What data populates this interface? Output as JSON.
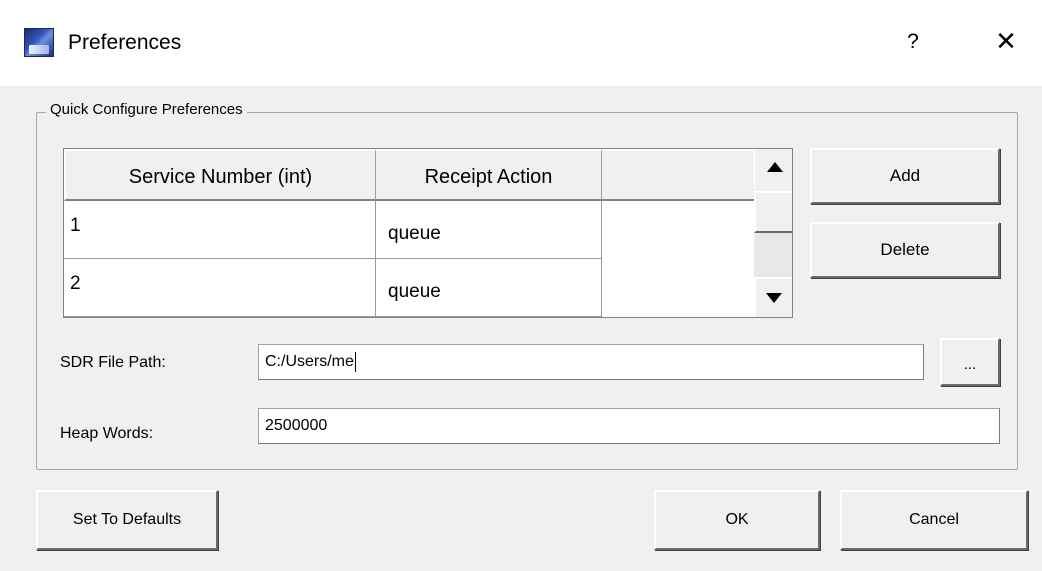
{
  "window": {
    "title": "Preferences",
    "help_label": "?",
    "close_label": "✕",
    "app_icon": "satellite-app-icon"
  },
  "group": {
    "title": "Quick Configure Preferences"
  },
  "table": {
    "columns": [
      "Service Number (int)",
      "Receipt Action"
    ],
    "rows": [
      {
        "service": "1",
        "action": "queue"
      },
      {
        "service": "2",
        "action": "queue"
      }
    ]
  },
  "buttons": {
    "add": "Add",
    "delete": "Delete",
    "browse": "...",
    "defaults": "Set To Defaults",
    "ok": "OK",
    "cancel": "Cancel"
  },
  "fields": {
    "sdr_label": "SDR File Path:",
    "sdr_value": "C:/Users/me",
    "heap_label": "Heap Words:",
    "heap_value": "2500000"
  }
}
